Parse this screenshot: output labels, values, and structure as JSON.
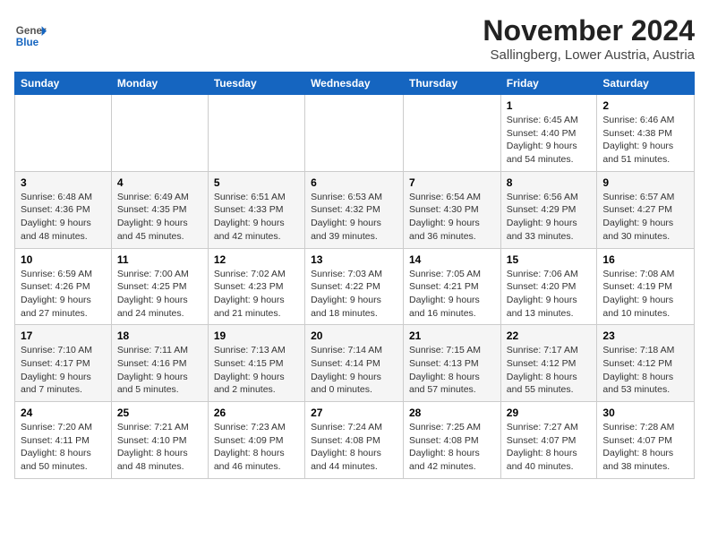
{
  "header": {
    "logo": {
      "general": "General",
      "blue": "Blue"
    },
    "title": "November 2024",
    "subtitle": "Sallingberg, Lower Austria, Austria"
  },
  "calendar": {
    "weekdays": [
      "Sunday",
      "Monday",
      "Tuesday",
      "Wednesday",
      "Thursday",
      "Friday",
      "Saturday"
    ],
    "weeks": [
      [
        {
          "day": "",
          "info": ""
        },
        {
          "day": "",
          "info": ""
        },
        {
          "day": "",
          "info": ""
        },
        {
          "day": "",
          "info": ""
        },
        {
          "day": "",
          "info": ""
        },
        {
          "day": "1",
          "info": "Sunrise: 6:45 AM\nSunset: 4:40 PM\nDaylight: 9 hours\nand 54 minutes."
        },
        {
          "day": "2",
          "info": "Sunrise: 6:46 AM\nSunset: 4:38 PM\nDaylight: 9 hours\nand 51 minutes."
        }
      ],
      [
        {
          "day": "3",
          "info": "Sunrise: 6:48 AM\nSunset: 4:36 PM\nDaylight: 9 hours\nand 48 minutes."
        },
        {
          "day": "4",
          "info": "Sunrise: 6:49 AM\nSunset: 4:35 PM\nDaylight: 9 hours\nand 45 minutes."
        },
        {
          "day": "5",
          "info": "Sunrise: 6:51 AM\nSunset: 4:33 PM\nDaylight: 9 hours\nand 42 minutes."
        },
        {
          "day": "6",
          "info": "Sunrise: 6:53 AM\nSunset: 4:32 PM\nDaylight: 9 hours\nand 39 minutes."
        },
        {
          "day": "7",
          "info": "Sunrise: 6:54 AM\nSunset: 4:30 PM\nDaylight: 9 hours\nand 36 minutes."
        },
        {
          "day": "8",
          "info": "Sunrise: 6:56 AM\nSunset: 4:29 PM\nDaylight: 9 hours\nand 33 minutes."
        },
        {
          "day": "9",
          "info": "Sunrise: 6:57 AM\nSunset: 4:27 PM\nDaylight: 9 hours\nand 30 minutes."
        }
      ],
      [
        {
          "day": "10",
          "info": "Sunrise: 6:59 AM\nSunset: 4:26 PM\nDaylight: 9 hours\nand 27 minutes."
        },
        {
          "day": "11",
          "info": "Sunrise: 7:00 AM\nSunset: 4:25 PM\nDaylight: 9 hours\nand 24 minutes."
        },
        {
          "day": "12",
          "info": "Sunrise: 7:02 AM\nSunset: 4:23 PM\nDaylight: 9 hours\nand 21 minutes."
        },
        {
          "day": "13",
          "info": "Sunrise: 7:03 AM\nSunset: 4:22 PM\nDaylight: 9 hours\nand 18 minutes."
        },
        {
          "day": "14",
          "info": "Sunrise: 7:05 AM\nSunset: 4:21 PM\nDaylight: 9 hours\nand 16 minutes."
        },
        {
          "day": "15",
          "info": "Sunrise: 7:06 AM\nSunset: 4:20 PM\nDaylight: 9 hours\nand 13 minutes."
        },
        {
          "day": "16",
          "info": "Sunrise: 7:08 AM\nSunset: 4:19 PM\nDaylight: 9 hours\nand 10 minutes."
        }
      ],
      [
        {
          "day": "17",
          "info": "Sunrise: 7:10 AM\nSunset: 4:17 PM\nDaylight: 9 hours\nand 7 minutes."
        },
        {
          "day": "18",
          "info": "Sunrise: 7:11 AM\nSunset: 4:16 PM\nDaylight: 9 hours\nand 5 minutes."
        },
        {
          "day": "19",
          "info": "Sunrise: 7:13 AM\nSunset: 4:15 PM\nDaylight: 9 hours\nand 2 minutes."
        },
        {
          "day": "20",
          "info": "Sunrise: 7:14 AM\nSunset: 4:14 PM\nDaylight: 9 hours\nand 0 minutes."
        },
        {
          "day": "21",
          "info": "Sunrise: 7:15 AM\nSunset: 4:13 PM\nDaylight: 8 hours\nand 57 minutes."
        },
        {
          "day": "22",
          "info": "Sunrise: 7:17 AM\nSunset: 4:12 PM\nDaylight: 8 hours\nand 55 minutes."
        },
        {
          "day": "23",
          "info": "Sunrise: 7:18 AM\nSunset: 4:12 PM\nDaylight: 8 hours\nand 53 minutes."
        }
      ],
      [
        {
          "day": "24",
          "info": "Sunrise: 7:20 AM\nSunset: 4:11 PM\nDaylight: 8 hours\nand 50 minutes."
        },
        {
          "day": "25",
          "info": "Sunrise: 7:21 AM\nSunset: 4:10 PM\nDaylight: 8 hours\nand 48 minutes."
        },
        {
          "day": "26",
          "info": "Sunrise: 7:23 AM\nSunset: 4:09 PM\nDaylight: 8 hours\nand 46 minutes."
        },
        {
          "day": "27",
          "info": "Sunrise: 7:24 AM\nSunset: 4:08 PM\nDaylight: 8 hours\nand 44 minutes."
        },
        {
          "day": "28",
          "info": "Sunrise: 7:25 AM\nSunset: 4:08 PM\nDaylight: 8 hours\nand 42 minutes."
        },
        {
          "day": "29",
          "info": "Sunrise: 7:27 AM\nSunset: 4:07 PM\nDaylight: 8 hours\nand 40 minutes."
        },
        {
          "day": "30",
          "info": "Sunrise: 7:28 AM\nSunset: 4:07 PM\nDaylight: 8 hours\nand 38 minutes."
        }
      ]
    ]
  }
}
